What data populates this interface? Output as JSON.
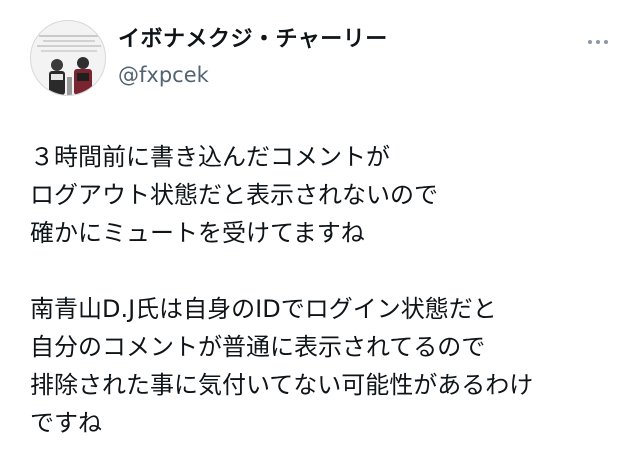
{
  "author": {
    "display_name": "イボナメクジ・チャーリー",
    "handle": "@fxpcek"
  },
  "icons": {
    "avatar": "user-avatar-image",
    "more": "more-options-icon"
  },
  "tweet": {
    "lines": [
      "３時間前に書き込んだコメントが",
      "ログアウト状態だと表示されないので",
      "確かにミュートを受けてますね",
      "",
      "南青山D.J氏は自身のIDでログイン状態だと",
      "自分のコメントが普通に表示されてるので",
      "排除された事に気付いてない可能性があるわけ",
      "ですね"
    ]
  }
}
